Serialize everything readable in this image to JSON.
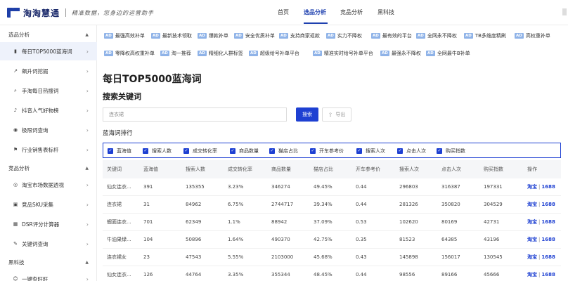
{
  "header": {
    "logo_name": "淘淘慧通",
    "slogan": "精准数据，您身边的运营助手",
    "nav": [
      "首页",
      "选品分析",
      "竞品分析",
      "黑科技"
    ],
    "active_nav": "选品分析"
  },
  "sidebar": {
    "groups": [
      {
        "label": "选品分析",
        "items": [
          {
            "label": "每日TOP5000蓝海词",
            "icon": "chart-bar-icon",
            "active": true
          },
          {
            "label": "飙升词挖掘",
            "icon": "trend-icon"
          },
          {
            "label": "手淘每日热搜词",
            "icon": "search-hot-icon"
          },
          {
            "label": "抖音人气好物榜",
            "icon": "tiktok-icon"
          },
          {
            "label": "极限词查询",
            "icon": "eye-icon"
          },
          {
            "label": "行业销售表标杆",
            "icon": "flag-icon"
          }
        ]
      },
      {
        "label": "竞品分析",
        "items": [
          {
            "label": "淘宝市场数据透视",
            "icon": "data-icon"
          },
          {
            "label": "竞品SKU采集",
            "icon": "collect-icon"
          },
          {
            "label": "DSR评分计算器",
            "icon": "calculator-icon"
          },
          {
            "label": "关键词查询",
            "icon": "keyword-icon"
          }
        ]
      },
      {
        "label": "黑科技",
        "items": [
          {
            "label": "一键查旺旺",
            "icon": "wangwang-icon"
          }
        ]
      }
    ]
  },
  "ad_badge": "AD",
  "tags_row1": [
    "最强高效补单",
    "最新技术领取",
    "爆款补单",
    "安全优质补单",
    "支持商家返款",
    "实力不降权",
    "最有效的平台",
    "全网永不降权",
    "TB多维度精刷",
    "高权重补单"
  ],
  "tags_row2": [
    "零降权高权重补单",
    "淘一推荐",
    "精细化人群标签",
    "超级给号补单平台",
    "精准实时给号补单平台",
    "最强永不降权",
    "全网最牛B补单"
  ],
  "page_title": "每日TOP5000蓝海词",
  "search_section": {
    "title": "搜索关键词",
    "input_value": "连衣裙",
    "search_label": "搜索",
    "export_label": "导出"
  },
  "rank_title": "蓝海词排行",
  "filters": [
    "蓝海值",
    "搜索人数",
    "成交转化率",
    "商品数量",
    "猫店占比",
    "开车参考价",
    "搜索人次",
    "点击人次",
    "购买指数"
  ],
  "table": {
    "headers": [
      "关键词",
      "蓝海值",
      "搜索人数",
      "成交转化率",
      "商品数量",
      "猫店占比",
      "开车参考价",
      "搜索人次",
      "点击人次",
      "购买指数",
      "操作"
    ],
    "rows": [
      [
        "仙女连衣...",
        "391",
        "135355",
        "3.23%",
        "346274",
        "49.45%",
        "0.44",
        "296803",
        "316387",
        "197331"
      ],
      [
        "连衣裙",
        "31",
        "84962",
        "6.75%",
        "2744717",
        "39.34%",
        "0.44",
        "281326",
        "350820",
        "304529"
      ],
      [
        "蝦面连衣...",
        "701",
        "62349",
        "1.1%",
        "88942",
        "37.09%",
        "0.53",
        "102620",
        "80169",
        "42731"
      ],
      [
        "牛油果绿...",
        "104",
        "50896",
        "1.64%",
        "490370",
        "42.75%",
        "0.35",
        "81523",
        "64385",
        "43196"
      ],
      [
        "连衣裙女",
        "23",
        "47543",
        "5.55%",
        "2103000",
        "45.68%",
        "0.43",
        "145898",
        "156017",
        "130545"
      ],
      [
        "仙女连衣...",
        "126",
        "44764",
        "3.35%",
        "355344",
        "48.45%",
        "0.44",
        "98556",
        "89166",
        "45666"
      ]
    ],
    "op_taobao": "淘宝",
    "op_1688": "1688",
    "op_sep": "|"
  },
  "colors": {
    "accent": "#1e40d2",
    "ad_badge": "#8fb3e8",
    "active_bg": "#eef2fb"
  }
}
